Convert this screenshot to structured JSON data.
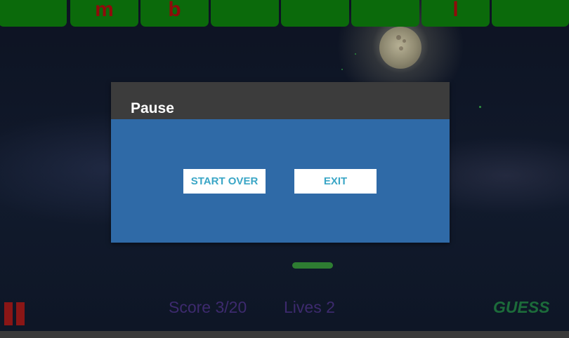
{
  "letter_tiles": [
    "",
    "m",
    "b",
    "",
    "",
    "",
    "l",
    ""
  ],
  "dialog": {
    "title": "Pause",
    "start_over_label": "START OVER",
    "exit_label": "EXIT"
  },
  "hud": {
    "score": "Score 3/20",
    "lives": "Lives 2",
    "guess_label": "GUESS"
  },
  "icons": {
    "pause": "pause-icon",
    "moon": "moon-icon"
  },
  "colors": {
    "tile_green": "#0b6a0b",
    "tile_letter": "#8f0b0b",
    "dialog_body": "#2f6aa7",
    "dialog_header": "#3c3c3c",
    "button_text": "#3aa6c6",
    "hud_text": "#3d2a6e",
    "guess": "#1c6b3a"
  }
}
